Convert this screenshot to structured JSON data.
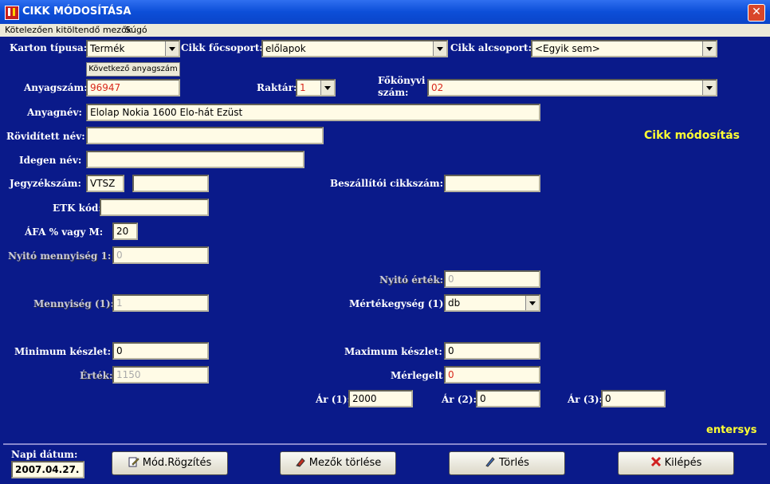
{
  "window": {
    "title": "CIKK MÓDOSÍTÁSA",
    "close": "✕"
  },
  "menu": {
    "required_fields": "Kötelezően kitöltendő mezők",
    "help": "Súgó"
  },
  "heading": "Cikk módosítás",
  "brand": "entersys",
  "form": {
    "karton_label": "Karton típusa:",
    "karton_value": "Termék",
    "focsoport_label": "Cikk főcsoport:",
    "focsoport_value": "előlapok",
    "alcsoport_label": "Cikk alcsoport:",
    "alcsoport_value": "<Egyik sem>",
    "next_code_btn": "Következő anyagszám",
    "anyagszam_label": "Anyagszám:",
    "anyagszam_value": "96947",
    "raktar_label": "Raktár:",
    "raktar_value": "1",
    "fokonyvi_label_1": "Főkönyvi",
    "fokonyvi_label_2": "szám:",
    "fokonyvi_value": "02",
    "anyagnev_label": "Anyagnév:",
    "anyagnev_value": "Elolap Nokia 1600 Elo-hát Ezüst",
    "rovid_label": "Rövidített név:",
    "rovid_value": "",
    "idegen_label": "Idegen név:",
    "idegen_value": "",
    "jegyzek_label": "Jegyzékszám:",
    "jegyzek_prefix": "VTSZ",
    "jegyzek_value": "",
    "beszallitoi_label": "Beszállítói cikkszám:",
    "beszallitoi_value": "",
    "etk_label": "ETK kód:",
    "etk_value": "",
    "afa_label": "ÁFA % vagy M:",
    "afa_value": "20",
    "nyito_menny_label": "Nyitó mennyiség 1:",
    "nyito_menny_value": "0",
    "nyito_ertek_label": "Nyitó érték:",
    "nyito_ertek_value": "0",
    "mennyiseg_label": "Mennyiség (1):",
    "mennyiseg_value": "1",
    "mertek_label": "Mértékegység (1):",
    "mertek_value": "db",
    "min_label": "Minimum készlet:",
    "min_value": "0",
    "max_label": "Maximum készlet:",
    "max_value": "0",
    "ertek_label": "Érték:",
    "ertek_value": "1150",
    "merlegelt_label": "Mérlegelt",
    "merlegelt_value": "0",
    "ar1_label": "Ár (1):",
    "ar1_value": "2000",
    "ar2_label": "Ár (2):",
    "ar2_value": "0",
    "ar3_label": "Ár (3):",
    "ar3_value": "0"
  },
  "footer": {
    "date_label": "Napi dátum:",
    "date_value": "2007.04.27.",
    "save_btn": "Mód.Rögzítés",
    "clear_btn": "Mezők törlése",
    "delete_btn": "Törlés",
    "exit_btn": "Kilépés"
  }
}
